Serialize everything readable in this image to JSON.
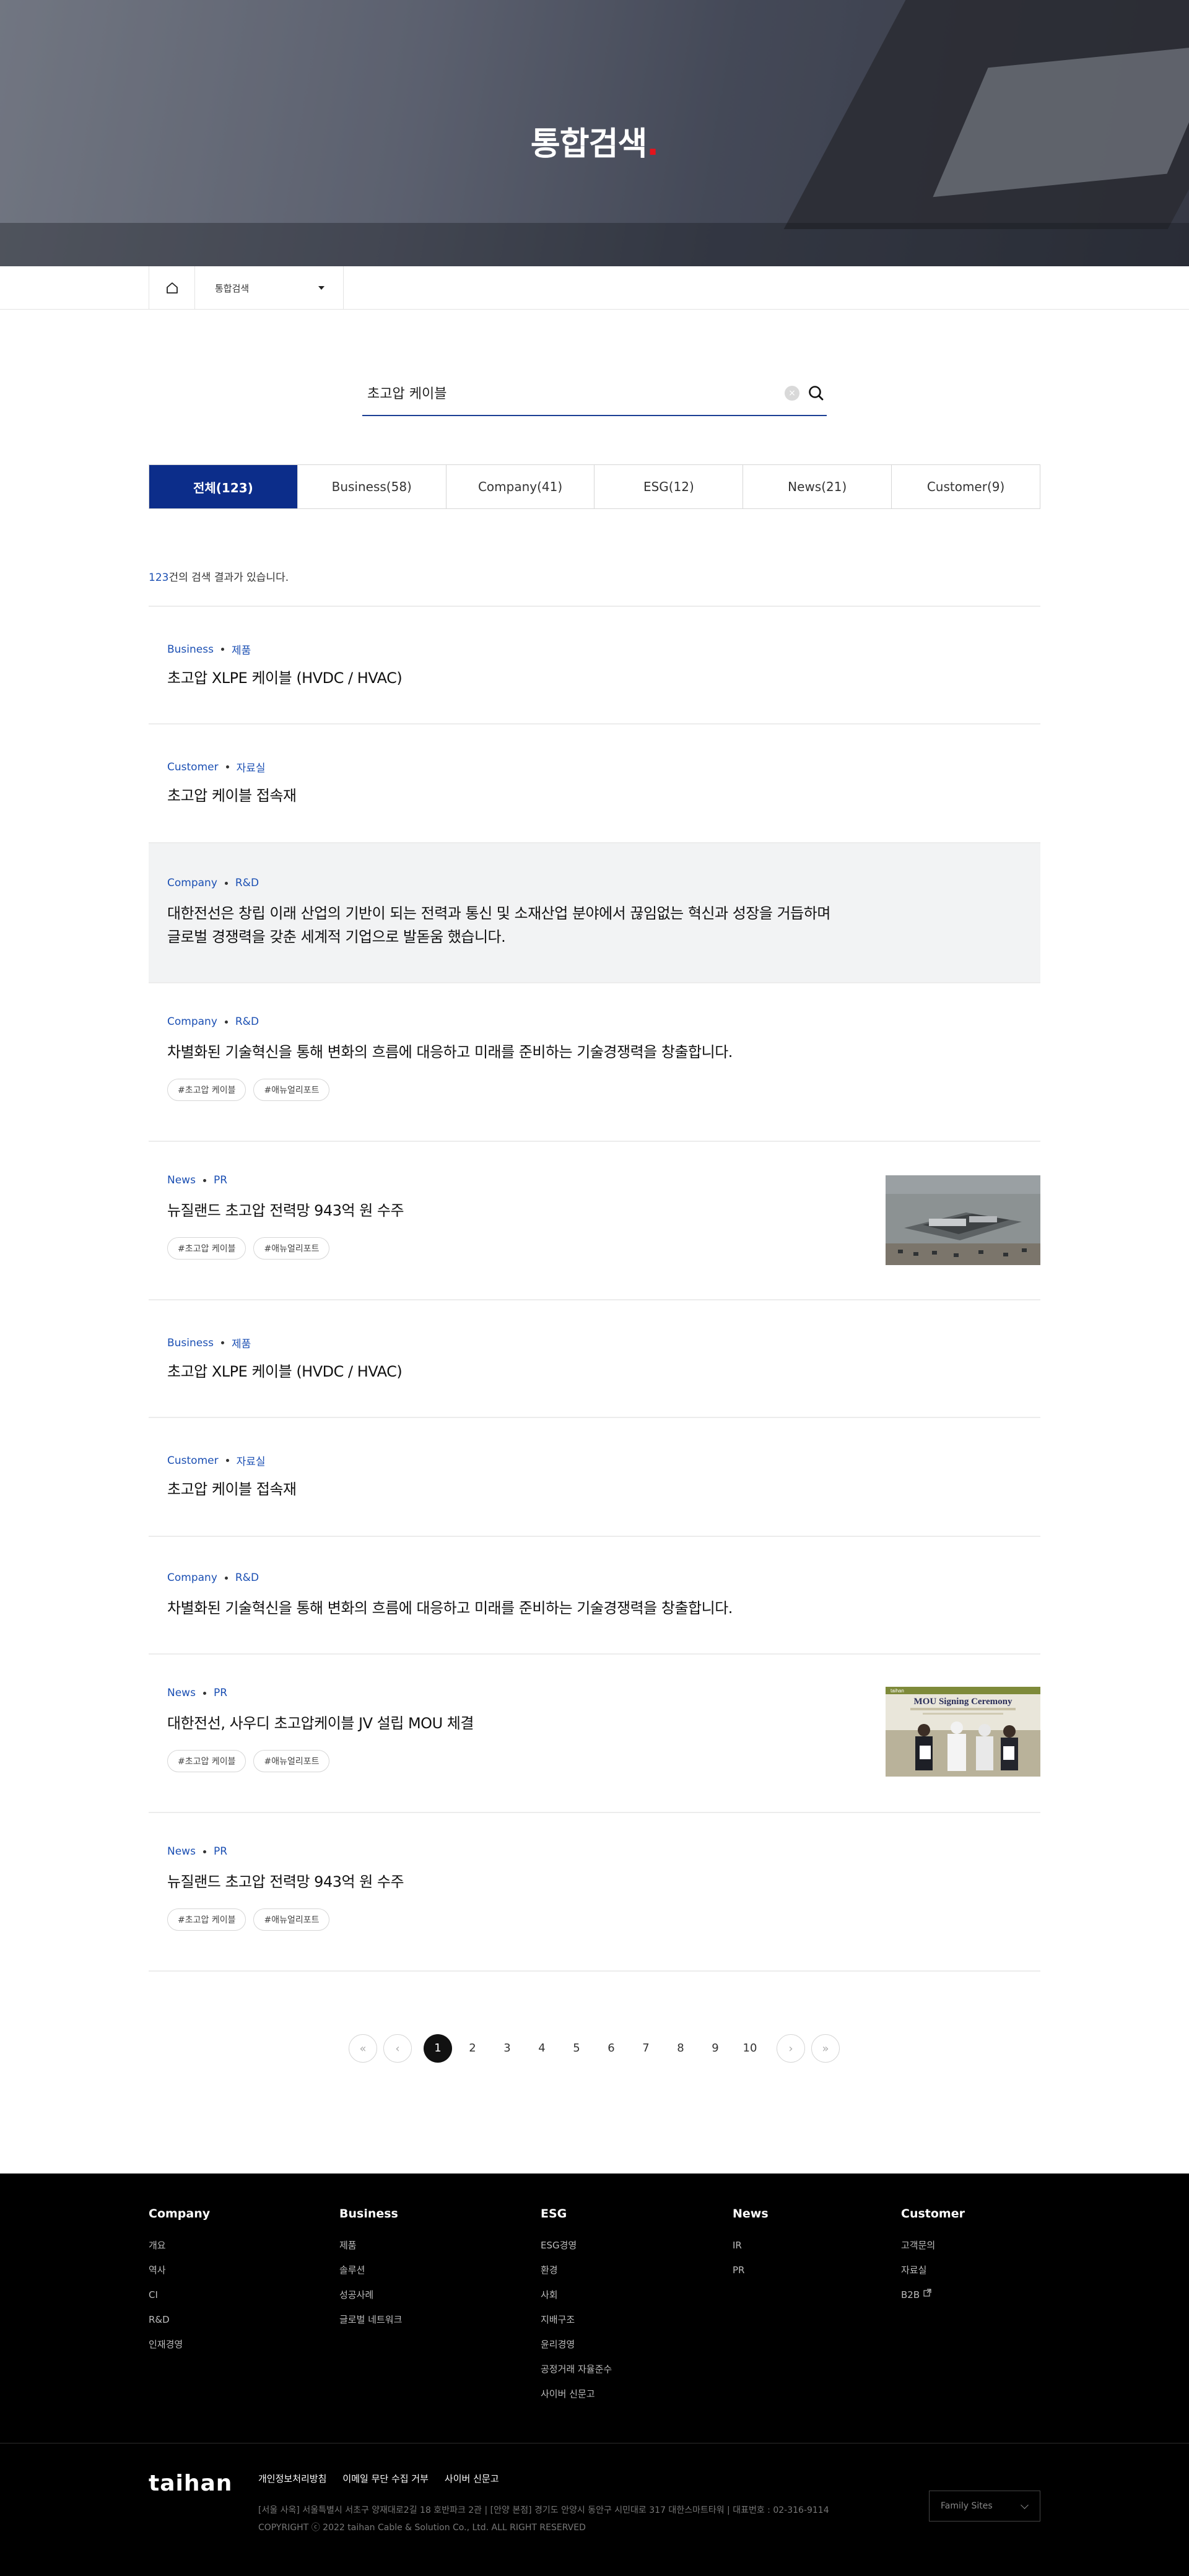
{
  "hero": {
    "title": "통합검색",
    "dot": "."
  },
  "subnav": {
    "home_icon": "home-icon",
    "dropdown_label": "통합검색"
  },
  "search": {
    "value": "초고압 케이블",
    "clear_label": "×"
  },
  "tabs": [
    {
      "label": "전체(123)",
      "active": true
    },
    {
      "label": "Business(58)"
    },
    {
      "label": "Company(41)"
    },
    {
      "label": "ESG(12)"
    },
    {
      "label": "News(21)"
    },
    {
      "label": "Customer(9)"
    }
  ],
  "count": {
    "number": "123",
    "suffix": "건의 검색 결과가 있습니다."
  },
  "results": [
    {
      "cat": "Business",
      "sub": "제품",
      "title": "초고압 XLPE 케이블 (HVDC / HVAC)"
    },
    {
      "cat": "Customer",
      "sub": "자료실",
      "title": "초고압 케이블 접속재"
    },
    {
      "cat": "Company",
      "sub": "R&D",
      "title_line1": "대한전선은 창립 이래 산업의 기반이 되는 전력과 통신 및 소재산업 분야에서 끊임없는 혁신과 성장을 거듭하며",
      "title_line2": "글로벌 경쟁력을 갖춘 세계적 기업으로 발돋움 했습니다."
    },
    {
      "cat": "Company",
      "sub": "R&D",
      "title": "차별화된 기술혁신을 통해 변화의 흐름에 대응하고 미래를 준비하는 기술경쟁력을 창출합니다.",
      "tags": [
        "#초고압 케이블",
        "#애뉴얼리포트"
      ]
    },
    {
      "cat": "News",
      "sub": "PR",
      "title": "뉴질랜드 초고압 전력망 943억 원 수주",
      "tags": [
        "#초고압 케이블",
        "#애뉴얼리포트"
      ]
    },
    {
      "cat": "Business",
      "sub": "제품",
      "title": "초고압 XLPE 케이블 (HVDC / HVAC)"
    },
    {
      "cat": "Customer",
      "sub": "자료실",
      "title": "초고압 케이블 접속재"
    },
    {
      "cat": "Company",
      "sub": "R&D",
      "title": "차별화된 기술혁신을 통해 변화의 흐름에 대응하고 미래를 준비하는 기술경쟁력을 창출합니다."
    },
    {
      "cat": "News",
      "sub": "PR",
      "title": "대한전선, 사우디 초고압케이블 JV 설립 MOU 체결",
      "tags": [
        "#초고압 케이블",
        "#애뉴얼리포트"
      ],
      "thumb_caption": "MOU Signing Ceremony",
      "thumb_brand": "taihan"
    },
    {
      "cat": "News",
      "sub": "PR",
      "title": "뉴질랜드 초고압 전력망 943억 원 수주",
      "tags": [
        "#초고압 케이블",
        "#애뉴얼리포트"
      ]
    }
  ],
  "pagination": {
    "first": "«",
    "prev": "‹",
    "next": "›",
    "last": "»",
    "pages": [
      "1",
      "2",
      "3",
      "4",
      "5",
      "6",
      "7",
      "8",
      "9",
      "10"
    ],
    "current": "1"
  },
  "footer": {
    "columns": [
      {
        "heading": "Company",
        "items": [
          "개요",
          "역사",
          "CI",
          "R&D",
          "인재경영"
        ]
      },
      {
        "heading": "Business",
        "items": [
          "제품",
          "솔루션",
          "성공사례",
          "글로벌 네트워크"
        ]
      },
      {
        "heading": "ESG",
        "items": [
          "ESG경영",
          "환경",
          "사회",
          "지배구조",
          "윤리경영",
          "공정거래 자율준수",
          "사이버 신문고"
        ]
      },
      {
        "heading": "News",
        "items": [
          "IR",
          "PR"
        ]
      },
      {
        "heading": "Customer",
        "items": [
          "고객문의",
          "자료실",
          "B2B"
        ]
      }
    ],
    "logo": "taihan",
    "links": [
      "개인정보처리방침",
      "이메일 무단 수집 거부",
      "사이버 신문고"
    ],
    "address": "[서울 사옥] 서울특별시 서초구 양재대로2길 18 호반파크 2관   |   [안양 본점] 경기도 안양시 동안구 시민대로 317 대한스마트타워   |   대표번호 : 02-316-9114",
    "copyright": "COPYRIGHT ⓒ 2022 taihan Cable & Solution Co., Ltd. ALL RIGHT RESERVED",
    "family_sites": "Family Sites"
  },
  "colors": {
    "accent": "#0c2d8a",
    "link": "#1b4fb3",
    "hero_dot": "#e5141c",
    "footer_bg": "#000000"
  }
}
